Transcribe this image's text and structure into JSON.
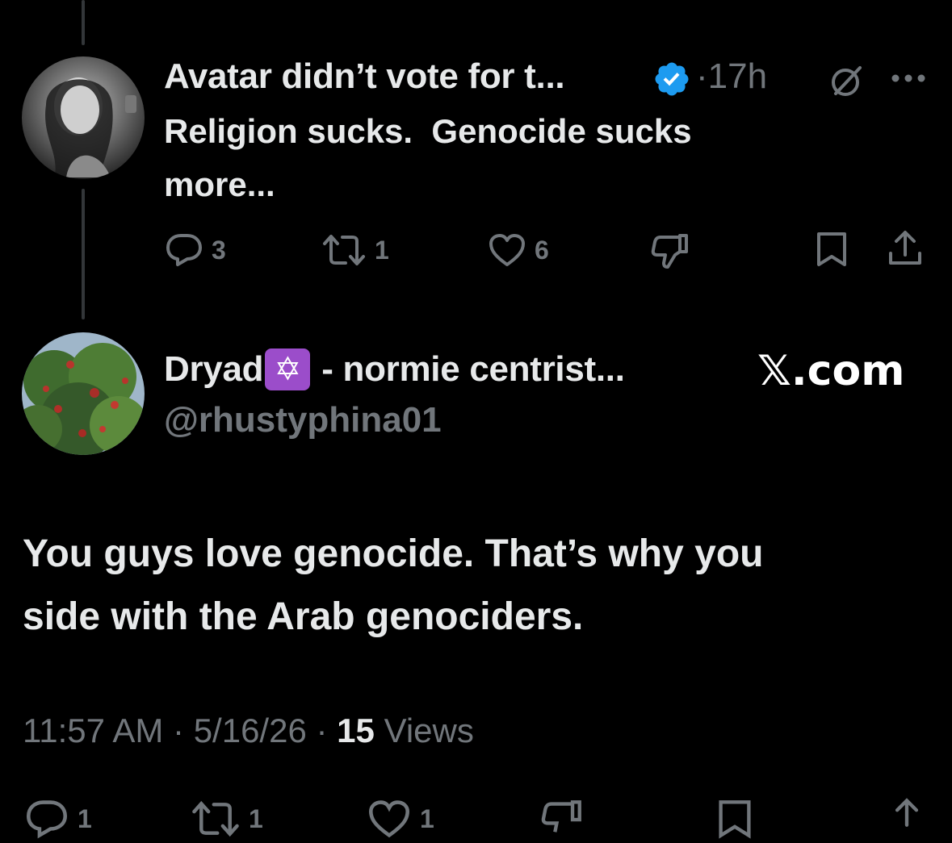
{
  "parent_tweet": {
    "display_name": "Avatar didn’t vote for t...",
    "separator": "·",
    "time": "17h",
    "text_line1": "Religion sucks.  Genocide sucks",
    "text_line2": "more...",
    "actions": {
      "replies": "3",
      "reposts": "1",
      "likes": "6"
    }
  },
  "main_tweet": {
    "display_name": "Dryad",
    "name_emoji": "✡",
    "name_suffix": "- normie centrist...",
    "handle": "@rhustyphina01",
    "watermark": "𝕏.com",
    "text_line1": "You guys love genocide. That’s why you",
    "text_line2": "side with the Arab genociders.",
    "meta": {
      "time": "11:57 AM",
      "sep1": "·",
      "date": "5/16/26",
      "sep2": "·",
      "views_count": "15",
      "views_label": "Views"
    },
    "bottom_actions": {
      "replies": "1",
      "reposts": "1",
      "likes": "1"
    }
  },
  "colors": {
    "background": "#000000",
    "text": "#e7e9ea",
    "muted": "#71767b",
    "verified": "#1d9bf0",
    "emoji_bg": "#9b4dca"
  }
}
